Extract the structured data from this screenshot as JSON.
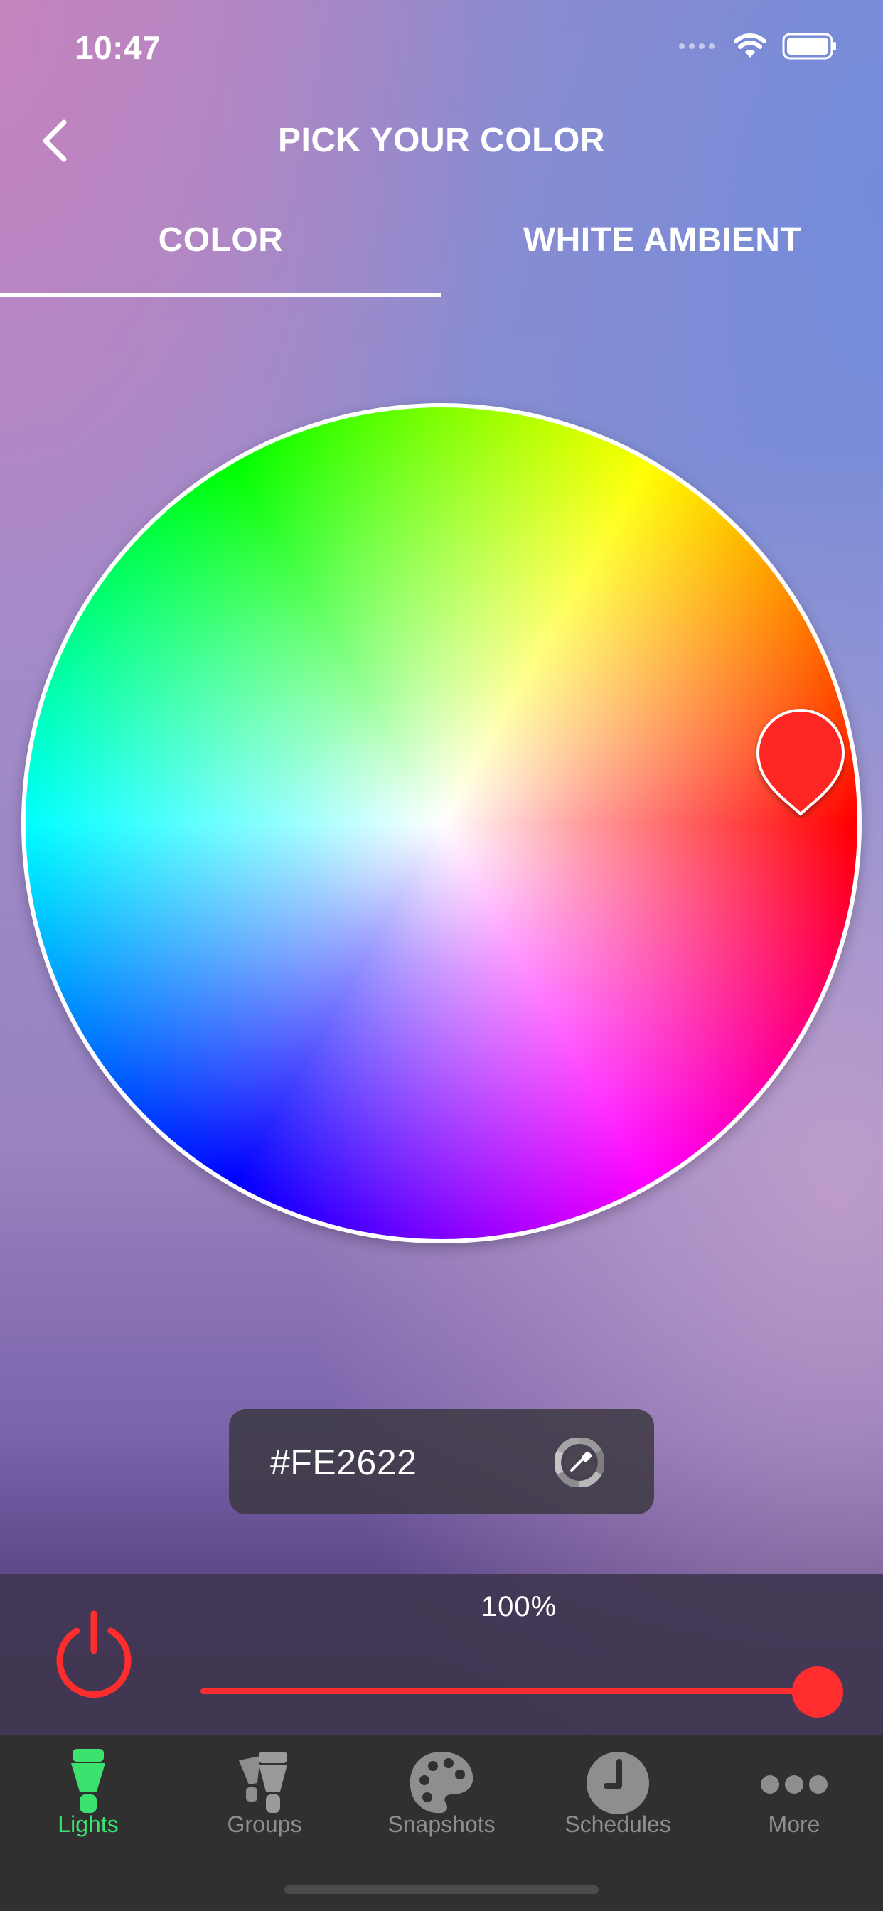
{
  "status_bar": {
    "time": "10:47"
  },
  "header": {
    "title": "PICK YOUR COLOR",
    "back_icon": "chevron-left-icon"
  },
  "tabs": [
    {
      "label": "COLOR",
      "selected": true
    },
    {
      "label": "WHITE AMBIENT",
      "selected": false
    }
  ],
  "color_picker": {
    "selected_color": "#FE2622",
    "selected_hex_label": "#FE2622"
  },
  "brightness": {
    "label": "100%",
    "value": 100
  },
  "power": {
    "state": "on",
    "color": "#FF2D2D"
  },
  "tab_bar": {
    "items": [
      {
        "label": "Lights",
        "icon": "bulb-icon",
        "active": true
      },
      {
        "label": "Groups",
        "icon": "group-bulbs-icon",
        "active": false
      },
      {
        "label": "Snapshots",
        "icon": "palette-icon",
        "active": false
      },
      {
        "label": "Schedules",
        "icon": "clock-icon",
        "active": false
      },
      {
        "label": "More",
        "icon": "more-dots-icon",
        "active": false
      }
    ],
    "active_color": "#3CE26E",
    "inactive_color": "#8E8E8E"
  }
}
